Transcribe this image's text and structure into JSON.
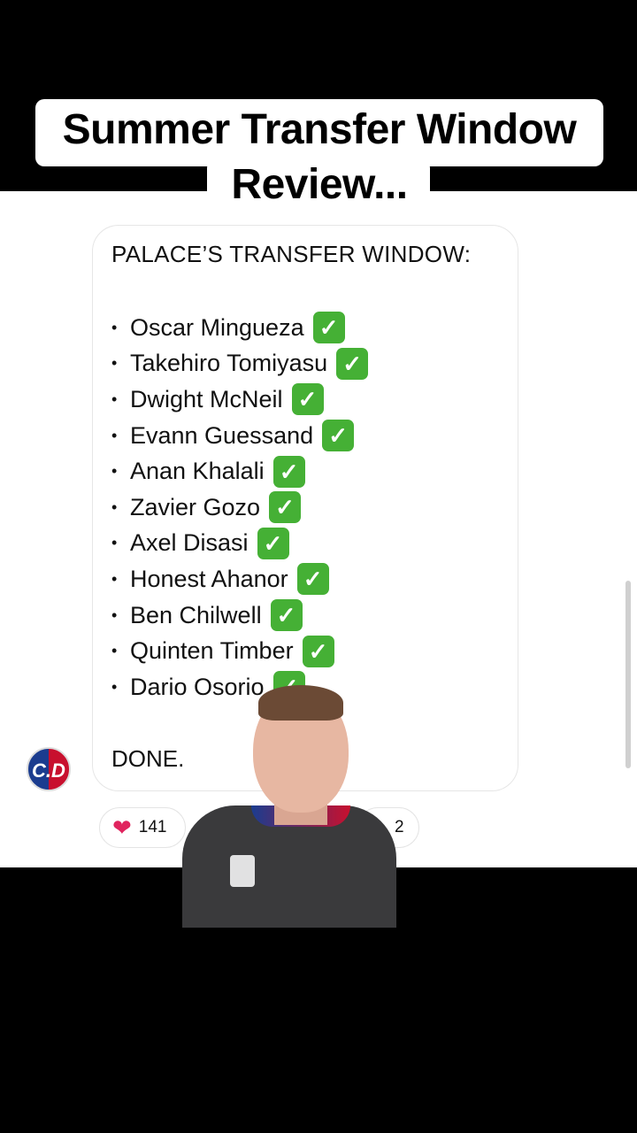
{
  "caption": {
    "line1": "Summer Transfer Window",
    "line2": "Review..."
  },
  "post": {
    "header": "PALACE’S TRANSFER WINDOW:",
    "items": [
      "Oscar Mingueza",
      "Takehiro Tomiyasu",
      "Dwight McNeil",
      "Evann Guessand",
      "Anan Khalali",
      "Zavier Gozo",
      "Axel Disasi",
      "Honest Ahanor",
      "Ben Chilwell",
      "Quinten Timber",
      "Dario Osorio"
    ],
    "bullet": "•",
    "check": "✓",
    "footer": "DONE."
  },
  "avatar": {
    "initials": "C.D"
  },
  "reactions": {
    "heart_icon": "❤",
    "likes": "141",
    "second_count_partial": "2"
  },
  "colors": {
    "check_green": "#45b035",
    "heart_red": "#e0245e",
    "background_black": "#000000"
  }
}
